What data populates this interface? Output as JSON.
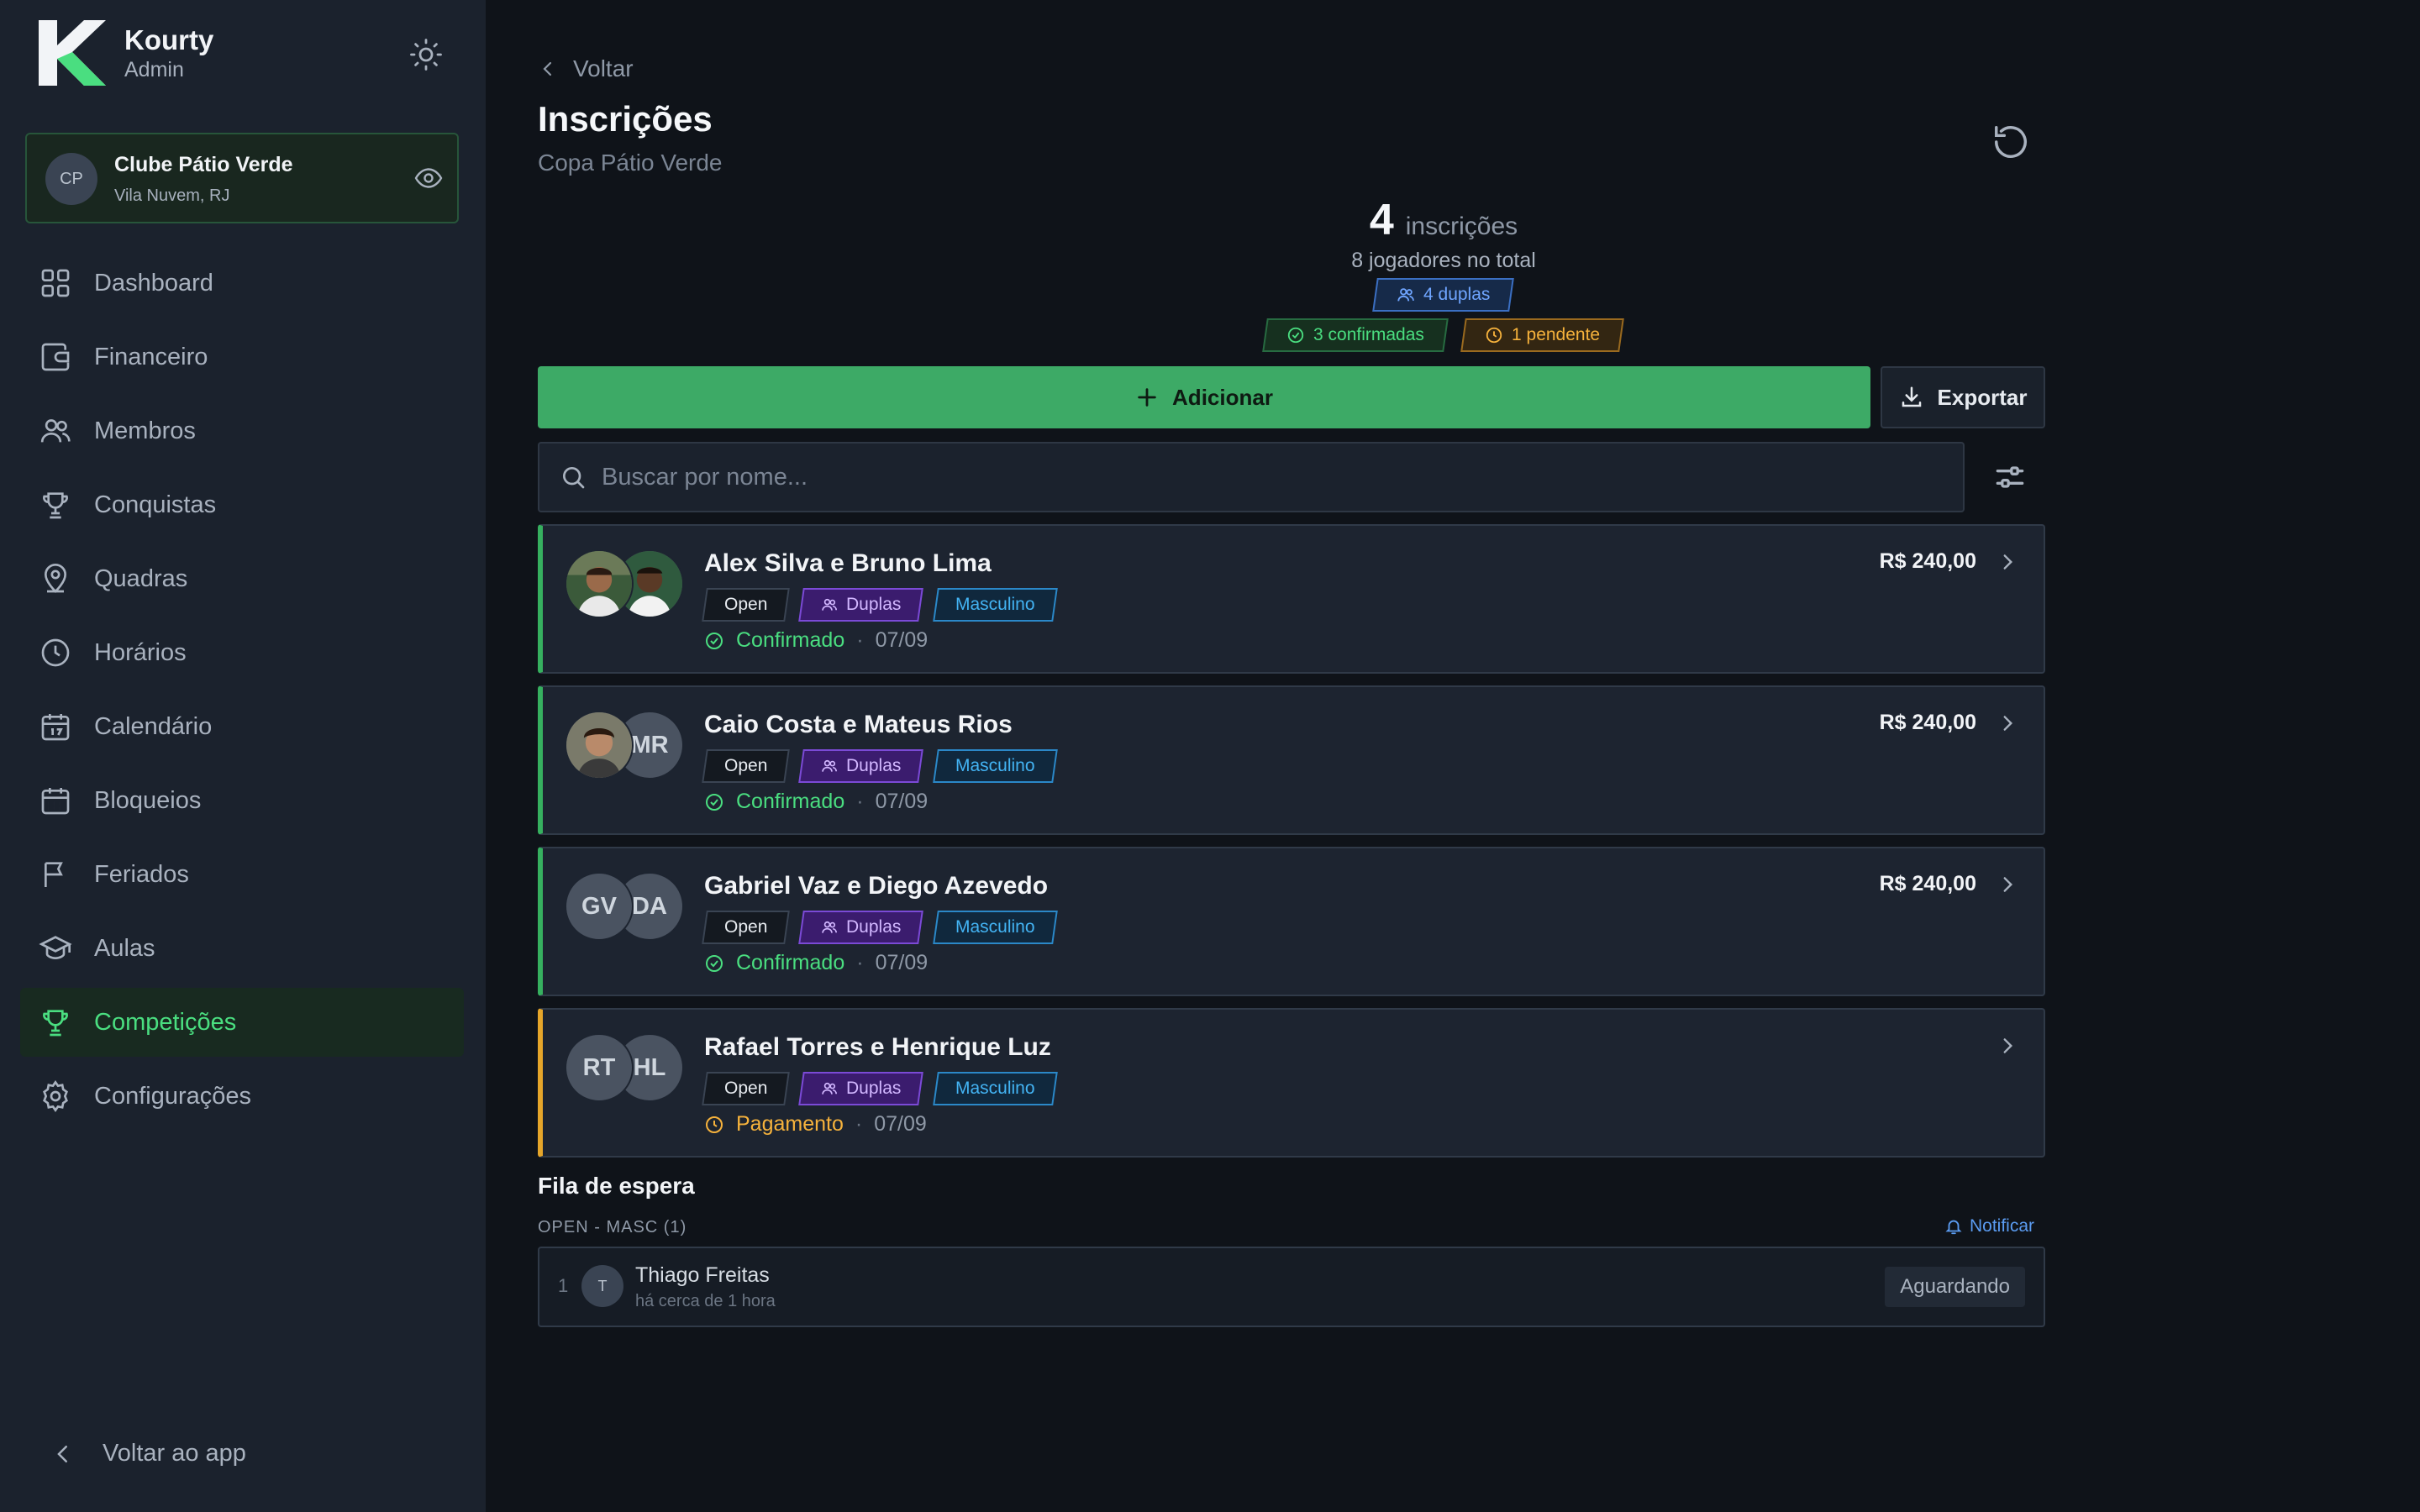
{
  "app": {
    "name": "Kourty",
    "role": "Admin"
  },
  "club": {
    "initials": "CP",
    "name": "Clube Pátio Verde",
    "location": "Vila Nuvem, RJ"
  },
  "nav": {
    "items": [
      {
        "label": "Dashboard",
        "icon": "grid-icon"
      },
      {
        "label": "Financeiro",
        "icon": "wallet-icon"
      },
      {
        "label": "Membros",
        "icon": "users-icon"
      },
      {
        "label": "Conquistas",
        "icon": "trophy-icon"
      },
      {
        "label": "Quadras",
        "icon": "map-pin-icon"
      },
      {
        "label": "Horários",
        "icon": "clock-icon"
      },
      {
        "label": "Calendário",
        "icon": "calendar-icon"
      },
      {
        "label": "Bloqueios",
        "icon": "calendar-grid-icon"
      },
      {
        "label": "Feriados",
        "icon": "flag-icon"
      },
      {
        "label": "Aulas",
        "icon": "graduation-cap-icon"
      },
      {
        "label": "Competições",
        "icon": "trophy-icon",
        "active": true
      },
      {
        "label": "Configurações",
        "icon": "gear-icon"
      }
    ],
    "back_label": "Voltar ao app"
  },
  "page": {
    "back_label": "Voltar",
    "title": "Inscrições",
    "subtitle": "Copa Pátio Verde"
  },
  "summary": {
    "count": "4",
    "count_label": "inscrições",
    "players": "8 jogadores no total",
    "duplas": "4 duplas",
    "confirmed": "3 confirmadas",
    "pending": "1 pendente"
  },
  "actions": {
    "add_label": "Adicionar",
    "export_label": "Exportar"
  },
  "search": {
    "placeholder": "Buscar por nome..."
  },
  "registrations": [
    {
      "name": "Alex Silva e Bruno Lima",
      "avatars": [
        "",
        ""
      ],
      "tags": [
        "Open",
        "Duplas",
        "Masculino"
      ],
      "status": "Confirmado",
      "status_type": "confirmed",
      "date": "07/09",
      "price": "R$ 240,00"
    },
    {
      "name": "Caio Costa e Mateus Rios",
      "avatars": [
        "",
        "MR"
      ],
      "tags": [
        "Open",
        "Duplas",
        "Masculino"
      ],
      "status": "Confirmado",
      "status_type": "confirmed",
      "date": "07/09",
      "price": "R$ 240,00"
    },
    {
      "name": "Gabriel Vaz e Diego Azevedo",
      "avatars": [
        "GV",
        "DA"
      ],
      "tags": [
        "Open",
        "Duplas",
        "Masculino"
      ],
      "status": "Confirmado",
      "status_type": "confirmed",
      "date": "07/09",
      "price": "R$ 240,00"
    },
    {
      "name": "Rafael Torres e Henrique Luz",
      "avatars": [
        "RT",
        "HL"
      ],
      "tags": [
        "Open",
        "Duplas",
        "Masculino"
      ],
      "status": "Pagamento",
      "status_type": "pending",
      "date": "07/09",
      "price": ""
    }
  ],
  "waitlist": {
    "title": "Fila de espera",
    "group": "OPEN - MASC (1)",
    "notify_label": "Notificar",
    "entries": [
      {
        "position": "1",
        "initial": "T",
        "name": "Thiago Freitas",
        "time": "há cerca de 1 hora",
        "status": "Aguardando"
      }
    ]
  },
  "colors": {
    "accent": "#3daa66",
    "confirmed": "#4ade80",
    "pending": "#f6b23c",
    "duplas": "#7b4ad6",
    "masculino": "#2b88c8"
  }
}
